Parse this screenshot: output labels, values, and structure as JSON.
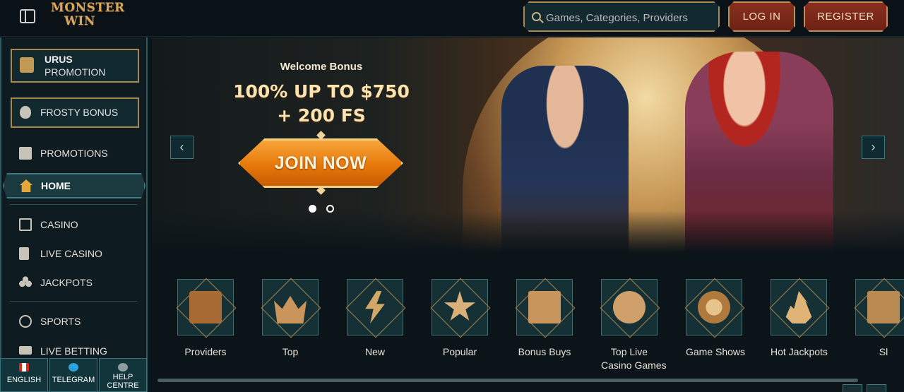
{
  "header": {
    "logo_text": "MONSTER WIN",
    "search_placeholder": "Games, Categories, Providers",
    "login_label": "LOG IN",
    "register_label": "REGISTER"
  },
  "sidebar": {
    "urus_brand": "URUS",
    "urus_label": "PROMOTION",
    "frosty_label": "FROSTY BONUS",
    "items": [
      {
        "label": "PROMOTIONS",
        "icon": "gift-icon"
      },
      {
        "label": "HOME",
        "icon": "home-icon"
      },
      {
        "label": "CASINO",
        "icon": "slot-machine-icon"
      },
      {
        "label": "LIVE CASINO",
        "icon": "cards-icon"
      },
      {
        "label": "JACKPOTS",
        "icon": "clover-icon"
      },
      {
        "label": "SPORTS",
        "icon": "basketball-icon"
      },
      {
        "label": "LIVE BETTING",
        "icon": "live-icon"
      }
    ]
  },
  "bottom_bar": {
    "language": "ENGLISH",
    "telegram": "TELEGRAM",
    "help_line1": "HELP",
    "help_line2": "CENTRE"
  },
  "hero": {
    "subtitle": "Welcome Bonus",
    "title_line1": "100% UP TO $750",
    "title_line2": "+ 200 FS",
    "cta_label": "JOIN NOW",
    "prev_glyph": "‹",
    "next_glyph": "›"
  },
  "categories": [
    {
      "label": "Providers",
      "icon": "book-icon"
    },
    {
      "label": "Top",
      "icon": "crown-icon"
    },
    {
      "label": "New",
      "icon": "lightning-icon"
    },
    {
      "label": "Popular",
      "icon": "star-icon"
    },
    {
      "label": "Bonus Buys",
      "icon": "gift-box-icon"
    },
    {
      "label": "Top Live",
      "label2": "Casino Games",
      "icon": "chip-icon"
    },
    {
      "label": "Game Shows",
      "icon": "wheel-icon"
    },
    {
      "label": "Hot Jackpots",
      "icon": "flame-icon"
    },
    {
      "label": "Sl",
      "icon": "slot-icon"
    }
  ],
  "colors": {
    "accent_gold": "#a9884f",
    "button_red": "#8a2f1e",
    "cta_orange": "#e7780a",
    "teal_panel": "#11292f"
  }
}
